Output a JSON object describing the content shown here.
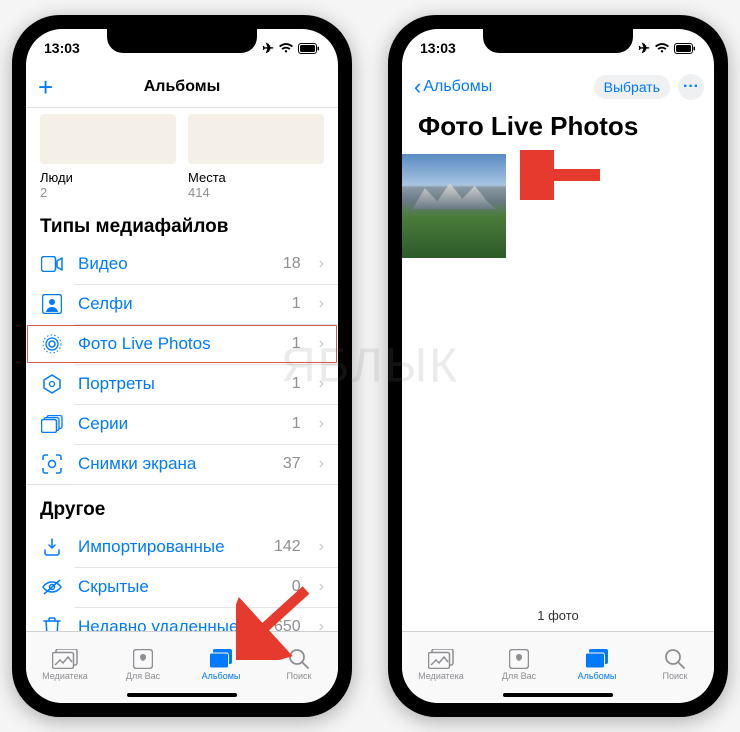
{
  "watermark": "ЯБЛЫК",
  "left": {
    "status": {
      "time": "13:03"
    },
    "header": {
      "add": "+",
      "title": "Альбомы"
    },
    "albums": {
      "people": {
        "name": "Люди",
        "count": "2"
      },
      "places": {
        "name": "Места",
        "count": "414"
      }
    },
    "section_media": "Типы медиафайлов",
    "media_rows": [
      {
        "icon": "video-icon",
        "label": "Видео",
        "count": "18"
      },
      {
        "icon": "selfie-icon",
        "label": "Селфи",
        "count": "1"
      },
      {
        "icon": "livephoto-icon",
        "label": "Фото Live Photos",
        "count": "1",
        "highlight": true
      },
      {
        "icon": "portrait-icon",
        "label": "Портреты",
        "count": "1"
      },
      {
        "icon": "burst-icon",
        "label": "Серии",
        "count": "1"
      },
      {
        "icon": "screenshot-icon",
        "label": "Снимки экрана",
        "count": "37"
      }
    ],
    "section_other": "Другое",
    "other_rows": [
      {
        "icon": "import-icon",
        "label": "Импортированные",
        "count": "142"
      },
      {
        "icon": "hidden-icon",
        "label": "Скрытые",
        "count": "0"
      },
      {
        "icon": "trash-icon",
        "label": "Недавно удаленные",
        "count": "650"
      }
    ],
    "tabs": {
      "library": "Медиатека",
      "foryou": "Для Вас",
      "albums": "Альбомы",
      "search": "Поиск"
    }
  },
  "right": {
    "status": {
      "time": "13:03"
    },
    "header": {
      "back": "Альбомы",
      "select": "Выбрать",
      "more": "···"
    },
    "title": "Фото Live Photos",
    "footer": "1 фото",
    "tabs": {
      "library": "Медиатека",
      "foryou": "Для Вас",
      "albums": "Альбомы",
      "search": "Поиск"
    }
  }
}
